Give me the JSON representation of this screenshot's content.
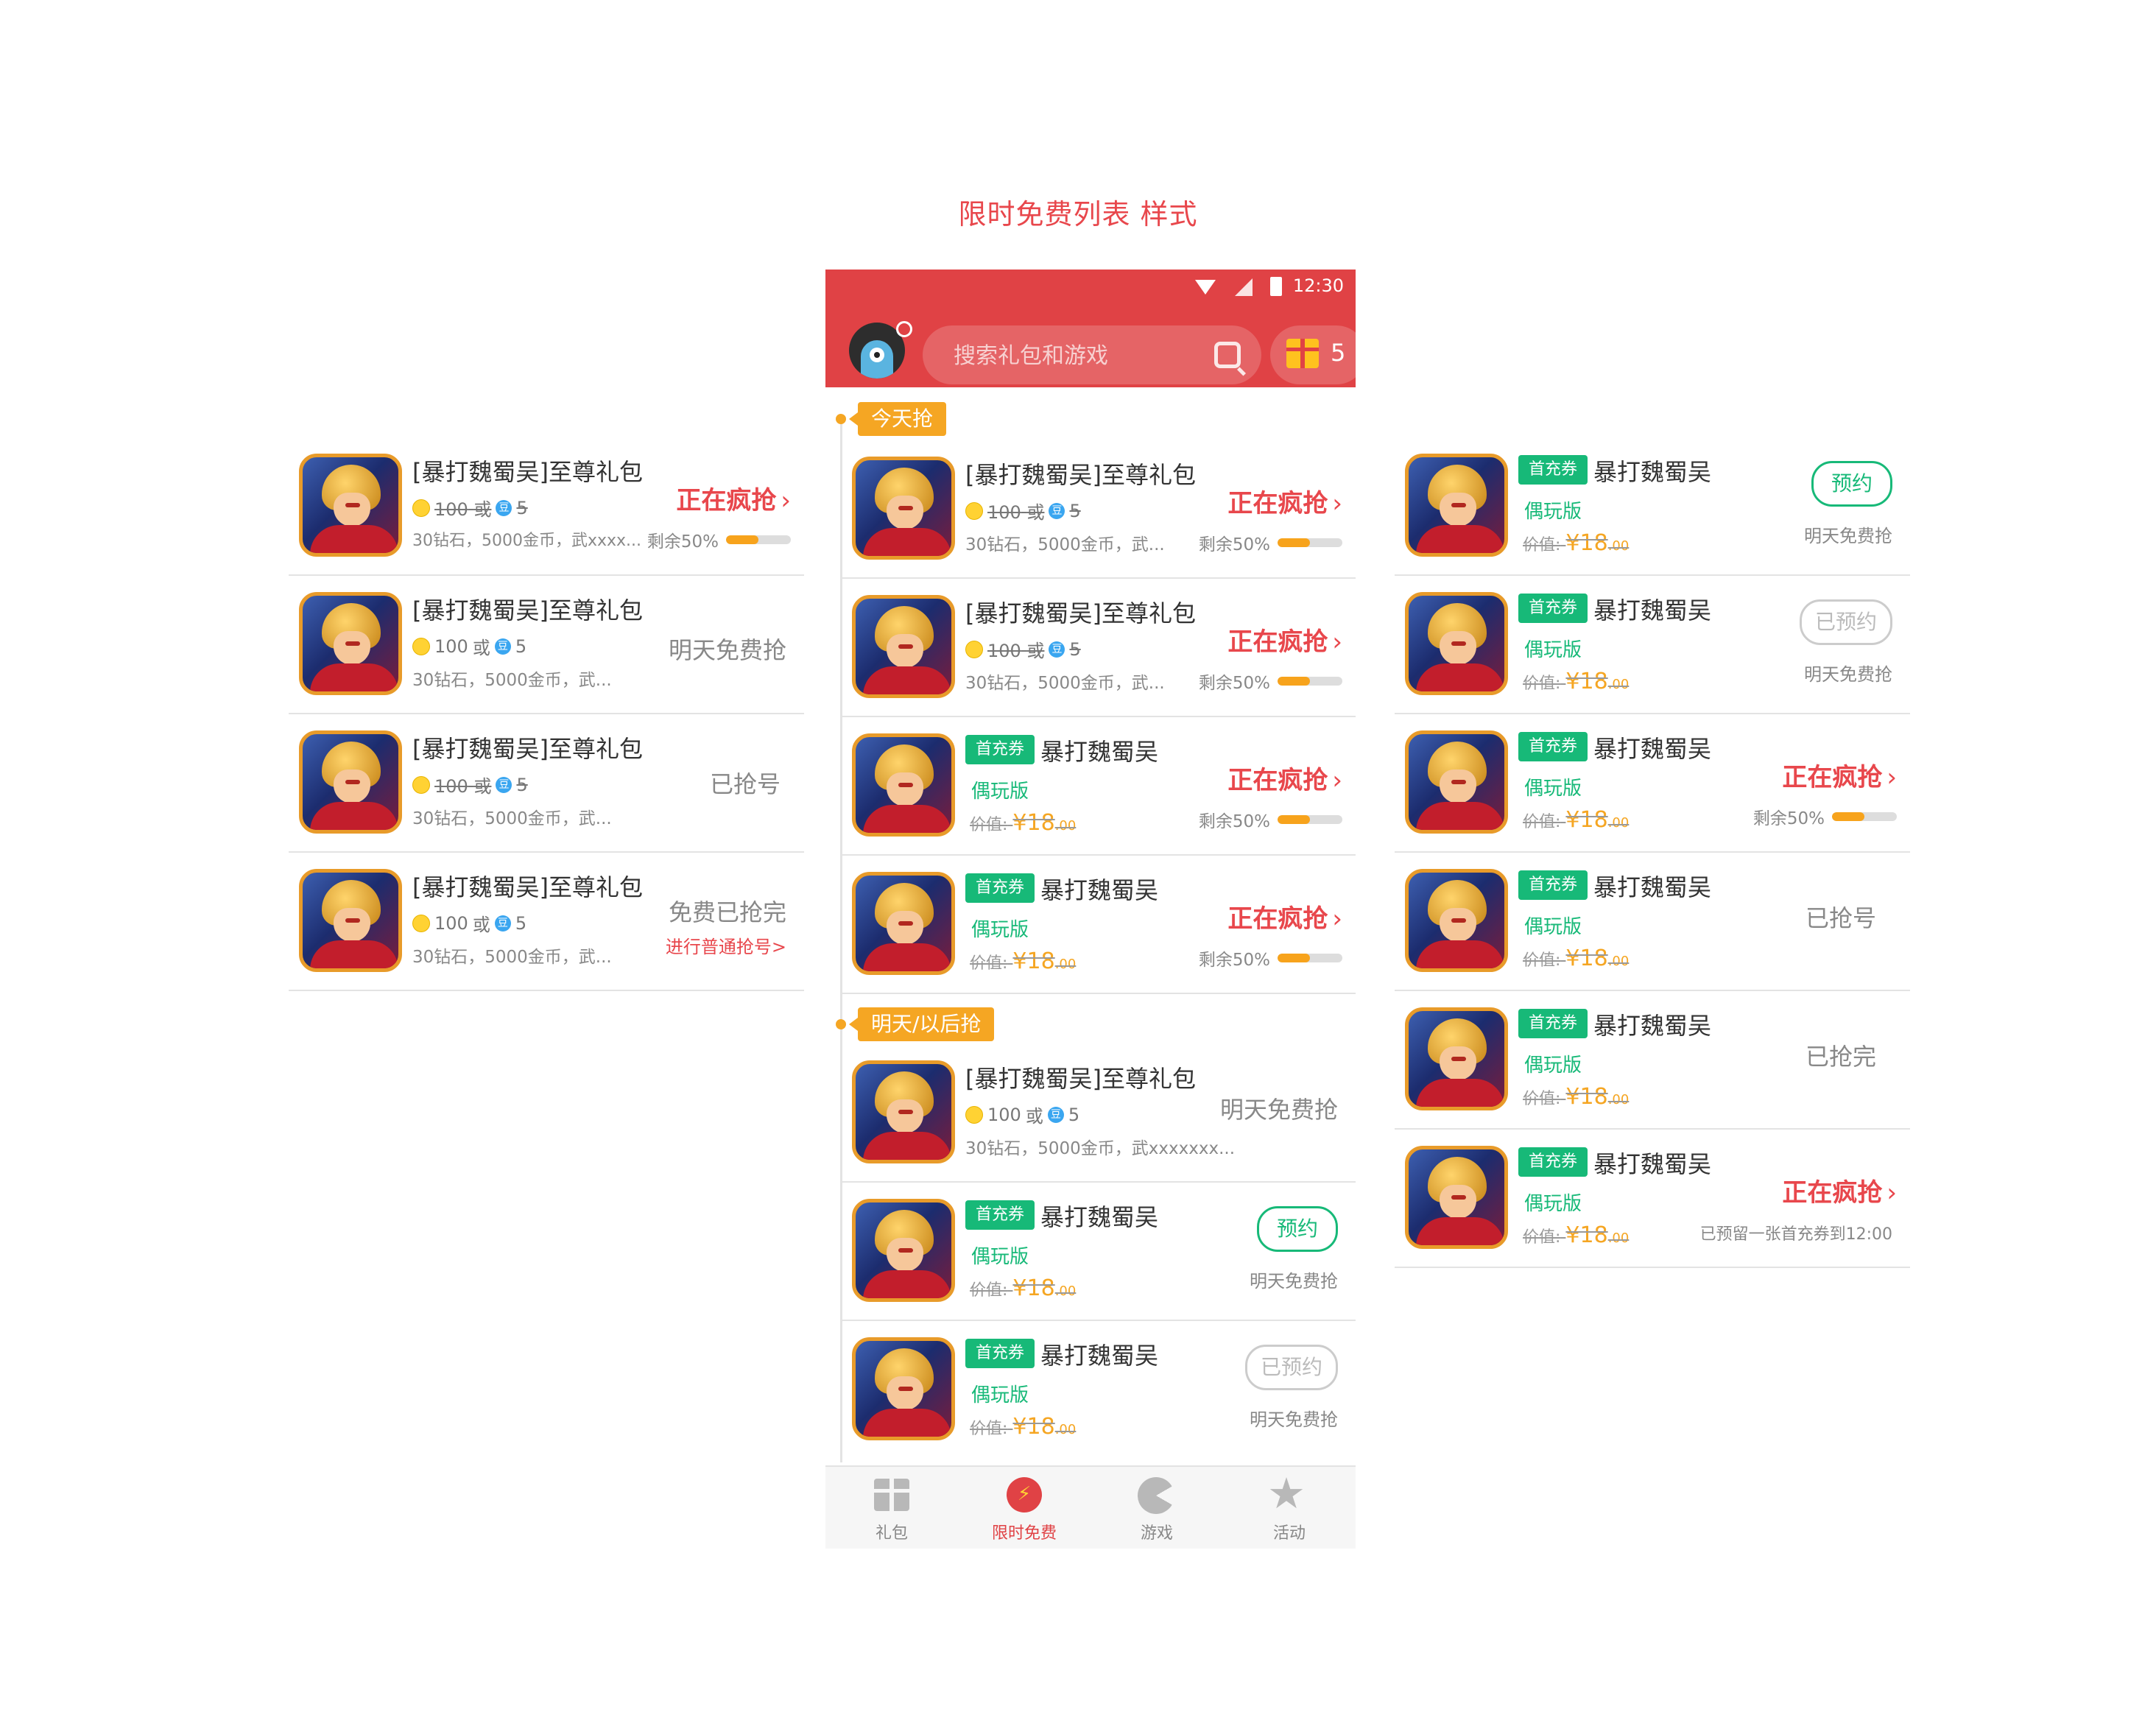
{
  "page_title": "限时免费列表 样式",
  "phone": {
    "status_time": "12:30",
    "search_placeholder": "搜索礼包和游戏",
    "gift_count": "5",
    "section_today": "今天抢",
    "section_later": "明天/以后抢",
    "tabs": [
      {
        "label": "礼包",
        "icon": "gift-icon"
      },
      {
        "label": "限时免费",
        "icon": "flash-clock-icon"
      },
      {
        "label": "游戏",
        "icon": "pacman-icon"
      },
      {
        "label": "活动",
        "icon": "star-icon"
      }
    ]
  },
  "common": {
    "pack_name": "[暴打魏蜀吴]至尊礼包",
    "game_name": "暴打魏蜀吴",
    "first_charge": "首充券",
    "ouwan": "偶玩版",
    "price_label": "价值:",
    "price_value": "¥18",
    "price_decimal": ".00",
    "coin_amount": "100",
    "or": "或",
    "dou_icon": "豆",
    "dou_amount": "5",
    "hot": "正在疯抢",
    "arrow": "›",
    "remain": "剩余50%",
    "remain_fraction": 0.5,
    "tomorrow_free": "明天免费抢",
    "reserve": "预约",
    "reserved": "已预约",
    "grabbed": "已抢号",
    "sold_out": "已抢完",
    "free_sold_out": "免费已抢完",
    "normal_grab_link": "进行普通抢号>",
    "reserved_note": "已预留一张首充券到12:00"
  },
  "left_desc": {
    "row1": "30钻石，5000金币，武xxxx...",
    "row_short": "30钻石，5000金币，武..."
  },
  "phone_desc": {
    "short": "30钻石，5000金币，武...",
    "long": "30钻石，5000金币，武xxxxxxx..."
  },
  "colors": {
    "brand_red": "#e04245",
    "accent_red": "#e8474c",
    "green": "#17b978",
    "orange": "#f5a623"
  }
}
